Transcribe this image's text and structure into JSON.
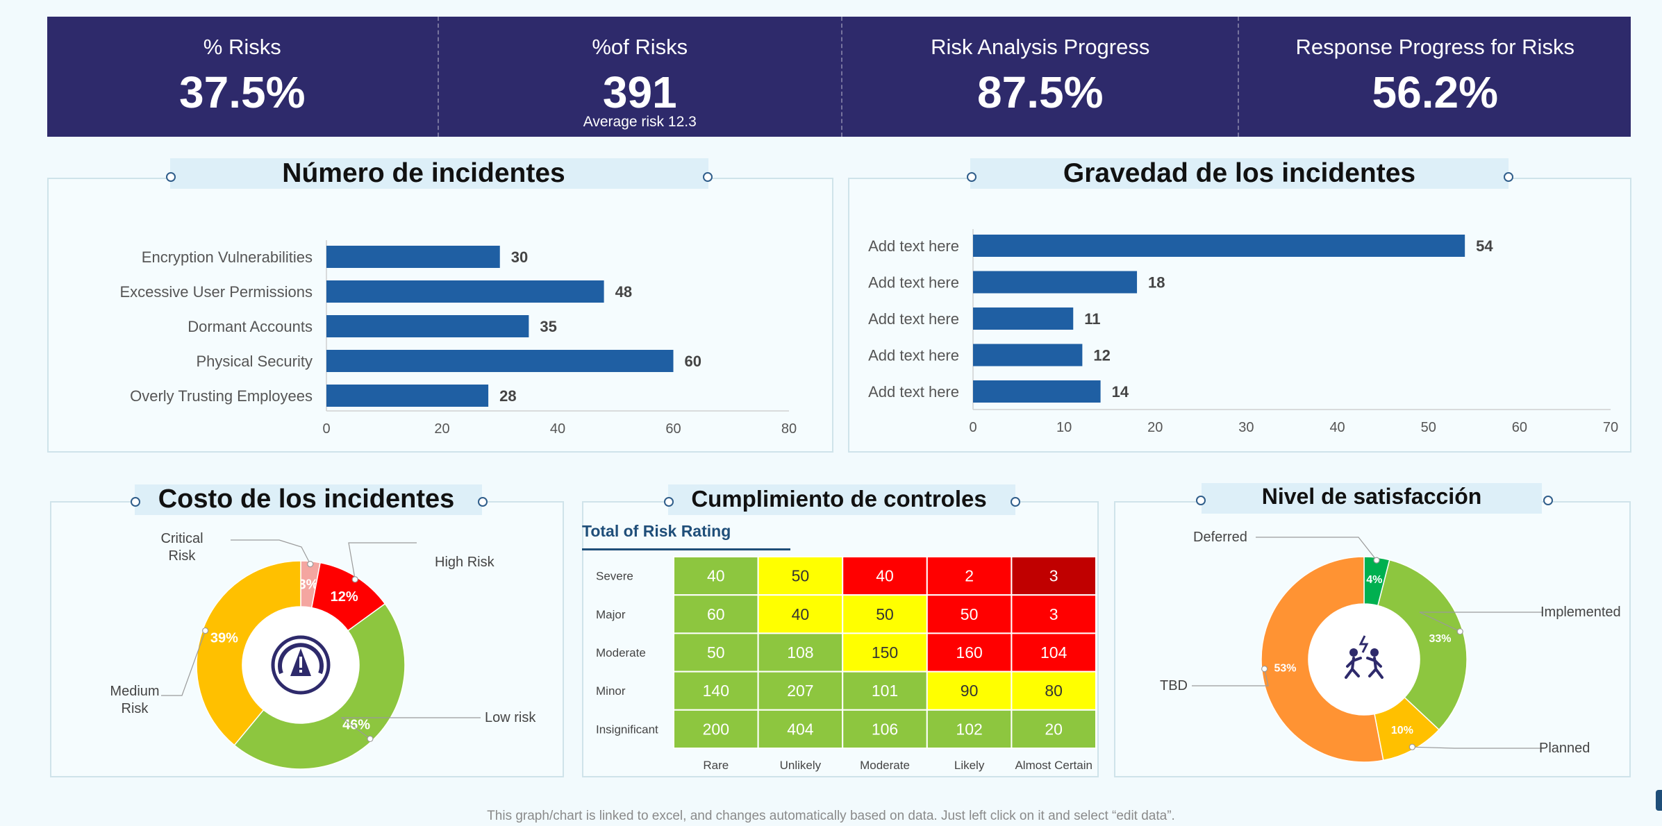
{
  "kpis": [
    {
      "label": "% Risks",
      "value": "37.5%",
      "sub": ""
    },
    {
      "label": "%of Risks",
      "value": "391",
      "sub": "Average risk 12.3"
    },
    {
      "label": "Risk Analysis Progress",
      "value": "87.5%",
      "sub": ""
    },
    {
      "label": "Response Progress for Risks",
      "value": "56.2%",
      "sub": ""
    }
  ],
  "titles": {
    "incidents": "Número de incidentes",
    "severity": "Gravedad de los incidentes",
    "cost": "Costo de los incidentes",
    "compliance": "Cumplimiento de controles",
    "satisfaction": "Nivel de satisfacción"
  },
  "risk_rating_label": "Total of Risk Rating",
  "footer": "This graph/chart is linked to excel, and changes automatically based on data. Just left click on it and select “edit data”.",
  "colors": {
    "bar": "#1f5fa3",
    "header": "#2e2a6b",
    "green": "#8dc63f",
    "yellow": "#ffff00",
    "red": "#ff0000",
    "dark_red": "#c00000",
    "orange": "#ff9333",
    "amber": "#ffc000",
    "teal_green": "#00b050",
    "pink": "#f4a6a0"
  },
  "chart_data": [
    {
      "type": "bar",
      "orientation": "horizontal",
      "title": "Número de incidentes",
      "categories": [
        "Encryption Vulnerabilities",
        "Excessive User Permissions",
        "Dormant Accounts",
        "Physical Security",
        "Overly Trusting Employees"
      ],
      "values": [
        30,
        48,
        35,
        60,
        28
      ],
      "xlim": [
        0,
        80
      ],
      "xticks": [
        0,
        20,
        40,
        60,
        80
      ]
    },
    {
      "type": "bar",
      "orientation": "horizontal",
      "title": "Gravedad de los incidentes",
      "categories": [
        "Add text here",
        "Add text here",
        "Add text here",
        "Add text here",
        "Add text here"
      ],
      "values": [
        54,
        18,
        11,
        12,
        14
      ],
      "xlim": [
        0,
        70
      ],
      "xticks": [
        0,
        10,
        20,
        30,
        40,
        50,
        60,
        70
      ]
    },
    {
      "type": "pie",
      "donut": true,
      "title": "Costo de los incidentes",
      "slices": [
        {
          "name": "Critical Risk",
          "value": 3,
          "label": "3%",
          "color": "#f4a6a0"
        },
        {
          "name": "High Risk",
          "value": 12,
          "label": "12%",
          "color": "#ff0000"
        },
        {
          "name": "Low risk",
          "value": 46,
          "label": "46%",
          "color": "#8dc63f"
        },
        {
          "name": "Medium Risk",
          "value": 39,
          "label": "39%",
          "color": "#ffc000"
        }
      ]
    },
    {
      "type": "heatmap",
      "title": "Cumplimiento de controles",
      "subtitle": "Total of Risk Rating",
      "rows": [
        "Severe",
        "Major",
        "Moderate",
        "Minor",
        "Insignificant"
      ],
      "cols": [
        "Rare",
        "Unlikely",
        "Moderate",
        "Likely",
        "Almost Certain"
      ],
      "values": [
        [
          40,
          50,
          40,
          2,
          3
        ],
        [
          60,
          40,
          50,
          50,
          3
        ],
        [
          50,
          108,
          150,
          160,
          104
        ],
        [
          140,
          207,
          101,
          90,
          80
        ],
        [
          200,
          404,
          106,
          102,
          20
        ]
      ],
      "cell_colors": [
        [
          "#8dc63f",
          "#ffff00",
          "#ff0000",
          "#ff0000",
          "#c00000"
        ],
        [
          "#8dc63f",
          "#ffff00",
          "#ffff00",
          "#ff0000",
          "#ff0000"
        ],
        [
          "#8dc63f",
          "#8dc63f",
          "#ffff00",
          "#ff0000",
          "#ff0000"
        ],
        [
          "#8dc63f",
          "#8dc63f",
          "#8dc63f",
          "#ffff00",
          "#ffff00"
        ],
        [
          "#8dc63f",
          "#8dc63f",
          "#8dc63f",
          "#8dc63f",
          "#8dc63f"
        ]
      ]
    },
    {
      "type": "pie",
      "donut": true,
      "title": "Nivel de satisfacción",
      "slices": [
        {
          "name": "Deferred",
          "value": 4,
          "label": "4%",
          "color": "#00b050"
        },
        {
          "name": "Implemented",
          "value": 33,
          "label": "33%",
          "color": "#8dc63f"
        },
        {
          "name": "Planned",
          "value": 10,
          "label": "10%",
          "color": "#ffc000"
        },
        {
          "name": "TBD",
          "value": 53,
          "label": "53%",
          "color": "#ff9333"
        }
      ]
    }
  ]
}
